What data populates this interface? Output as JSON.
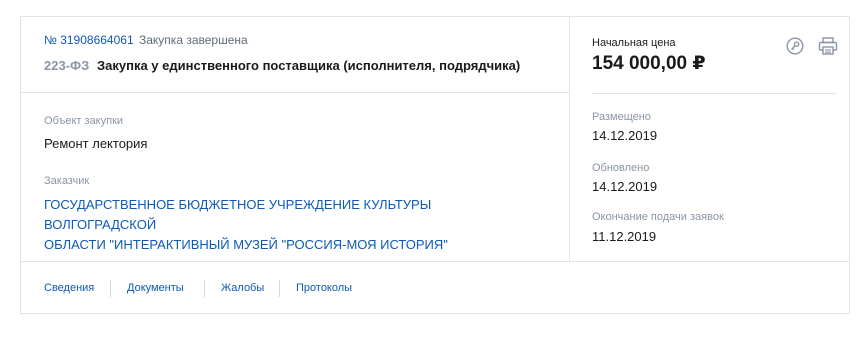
{
  "header": {
    "number": "№ 31908664061",
    "status": "Закупка завершена",
    "law": "223-ФЗ",
    "method": "Закупка у единственного поставщика (исполнителя, подрядчика)"
  },
  "object": {
    "label": "Объект закупки",
    "value": "Ремонт лектория"
  },
  "customer": {
    "label": "Заказчик",
    "line1": "ГОСУДАРСТВЕННОЕ БЮДЖЕТНОЕ УЧРЕЖДЕНИЕ КУЛЬТУРЫ ВОЛГОГРАДСКОЙ",
    "line2": "ОБЛАСТИ \"ИНТЕРАКТИВНЫЙ МУЗЕЙ \"РОССИЯ-МОЯ ИСТОРИЯ\""
  },
  "price": {
    "label": "Начальная цена",
    "value": "154 000,00 ₽"
  },
  "dates": {
    "posted_label": "Размещено",
    "posted": "14.12.2019",
    "updated_label": "Обновлено",
    "updated": "14.12.2019",
    "deadline_label": "Окончание подачи заявок",
    "deadline": "11.12.2019"
  },
  "icons": {
    "accent": "#8a95a5",
    "link": "#0d5ab7",
    "list": [
      "key-icon",
      "printer-icon"
    ]
  },
  "tabs": [
    "Сведения",
    "Документы",
    "Жалобы",
    "Протоколы"
  ]
}
